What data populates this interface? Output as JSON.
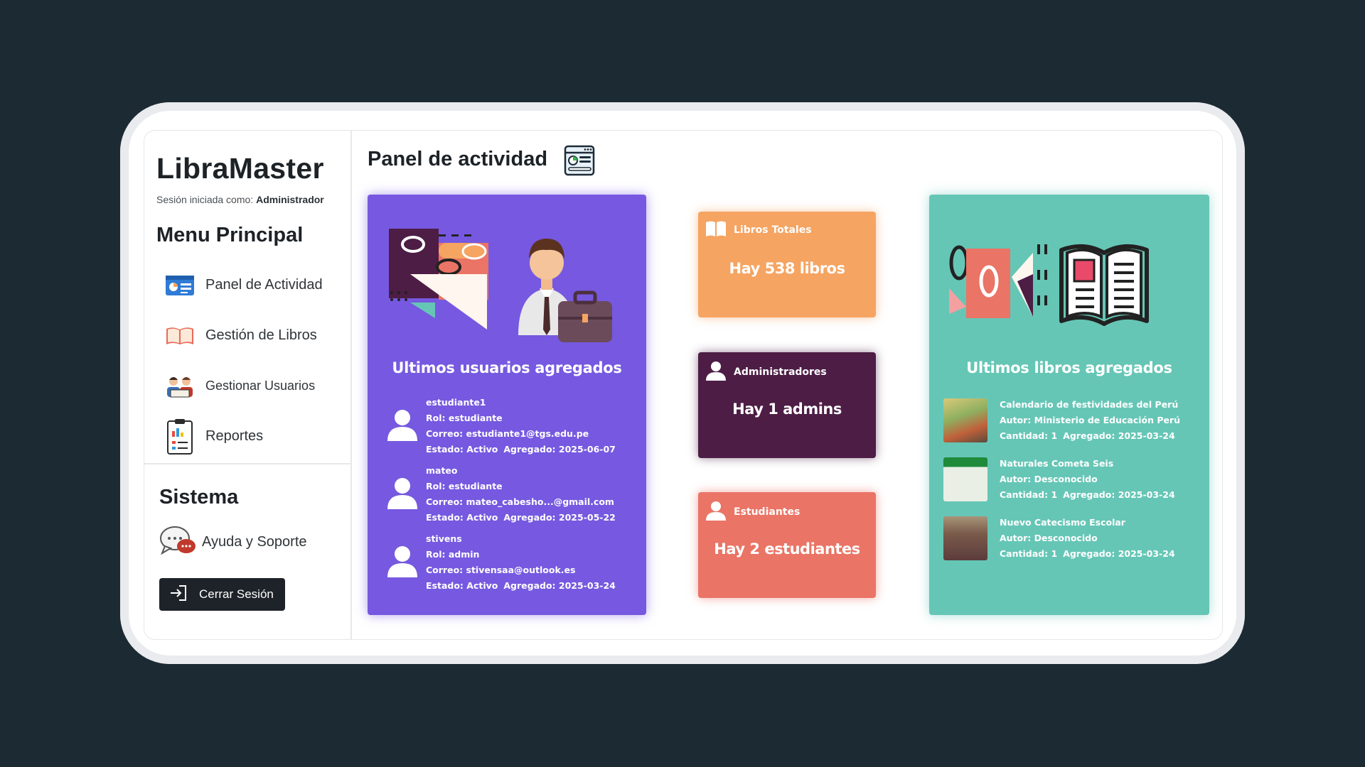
{
  "sidebar": {
    "brand": "LibraMaster",
    "session_prefix": "Sesión iniciada como: ",
    "session_role": "Administrador",
    "menu_title": "Menu Principal",
    "items": [
      {
        "label": "Panel de Actividad",
        "icon": "dashboard-card-icon"
      },
      {
        "label": "Gestión de Libros",
        "icon": "open-book-icon"
      },
      {
        "label": "Gestionar Usuarios",
        "icon": "users-group-icon"
      },
      {
        "label": "Reportes",
        "icon": "clipboard-report-icon"
      }
    ],
    "system_title": "Sistema",
    "help_label": "Ayuda y Soporte",
    "logout_label": "Cerrar Sesión"
  },
  "main": {
    "title": "Panel de actividad",
    "users_heading": "Ultimos usuarios agregados",
    "users": [
      {
        "name": "estudiante1",
        "role": "Rol: estudiante",
        "email": "Correo: estudiante1@tgs.edu.pe",
        "status": "Estado: Activo",
        "added": "Agregado: 2025-06-07"
      },
      {
        "name": "mateo",
        "role": "Rol: estudiante",
        "email": "Correo: mateo_cabesho...@gmail.com",
        "status": "Estado: Activo",
        "added": "Agregado: 2025-05-22"
      },
      {
        "name": "stivens",
        "role": "Rol: admin",
        "email": "Correo: stivensaa@outlook.es",
        "status": "Estado: Activo",
        "added": "Agregado: 2025-03-24"
      }
    ],
    "stats": {
      "books_label": "Libros Totales",
      "books_value": "Hay 538 libros",
      "admins_label": "Administradores",
      "admins_value": "Hay 1 admins",
      "students_label": "Estudiantes",
      "students_value": "Hay 2 estudiantes"
    },
    "books_heading": "Ultimos libros agregados",
    "books": [
      {
        "title": "Calendario de festividades del Perú",
        "author": "Autor: Ministerio de Educación Perú",
        "qty": "Cantidad: 1",
        "added": "Agregado: 2025-03-24"
      },
      {
        "title": "Naturales Cometa Seis",
        "author": "Autor: Desconocido",
        "qty": "Cantidad: 1",
        "added": "Agregado: 2025-03-24"
      },
      {
        "title": "Nuevo Catecismo Escolar",
        "author": "Autor: Desconocido",
        "qty": "Cantidad: 1",
        "added": "Agregado: 2025-03-24"
      }
    ]
  },
  "colors": {
    "users_card": "#7659e0",
    "books_card": "#66c6b6",
    "stat_books": "#f5a462",
    "stat_admins": "#4d1d45",
    "stat_students": "#ea7465",
    "background": "#1c2a33"
  }
}
